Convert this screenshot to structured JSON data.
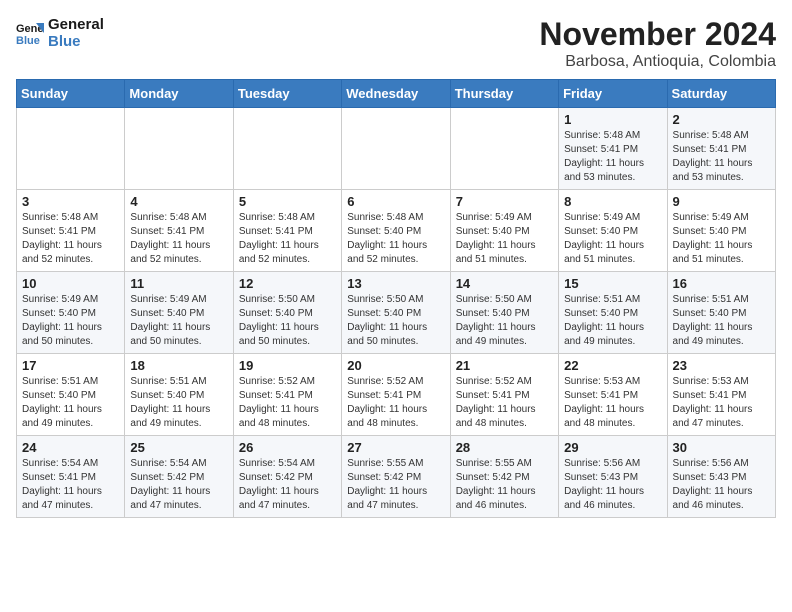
{
  "header": {
    "logo_line1": "General",
    "logo_line2": "Blue",
    "month_title": "November 2024",
    "subtitle": "Barbosa, Antioquia, Colombia"
  },
  "weekdays": [
    "Sunday",
    "Monday",
    "Tuesday",
    "Wednesday",
    "Thursday",
    "Friday",
    "Saturday"
  ],
  "weeks": [
    [
      {
        "day": "",
        "info": ""
      },
      {
        "day": "",
        "info": ""
      },
      {
        "day": "",
        "info": ""
      },
      {
        "day": "",
        "info": ""
      },
      {
        "day": "",
        "info": ""
      },
      {
        "day": "1",
        "info": "Sunrise: 5:48 AM\nSunset: 5:41 PM\nDaylight: 11 hours\nand 53 minutes."
      },
      {
        "day": "2",
        "info": "Sunrise: 5:48 AM\nSunset: 5:41 PM\nDaylight: 11 hours\nand 53 minutes."
      }
    ],
    [
      {
        "day": "3",
        "info": "Sunrise: 5:48 AM\nSunset: 5:41 PM\nDaylight: 11 hours\nand 52 minutes."
      },
      {
        "day": "4",
        "info": "Sunrise: 5:48 AM\nSunset: 5:41 PM\nDaylight: 11 hours\nand 52 minutes."
      },
      {
        "day": "5",
        "info": "Sunrise: 5:48 AM\nSunset: 5:41 PM\nDaylight: 11 hours\nand 52 minutes."
      },
      {
        "day": "6",
        "info": "Sunrise: 5:48 AM\nSunset: 5:40 PM\nDaylight: 11 hours\nand 52 minutes."
      },
      {
        "day": "7",
        "info": "Sunrise: 5:49 AM\nSunset: 5:40 PM\nDaylight: 11 hours\nand 51 minutes."
      },
      {
        "day": "8",
        "info": "Sunrise: 5:49 AM\nSunset: 5:40 PM\nDaylight: 11 hours\nand 51 minutes."
      },
      {
        "day": "9",
        "info": "Sunrise: 5:49 AM\nSunset: 5:40 PM\nDaylight: 11 hours\nand 51 minutes."
      }
    ],
    [
      {
        "day": "10",
        "info": "Sunrise: 5:49 AM\nSunset: 5:40 PM\nDaylight: 11 hours\nand 50 minutes."
      },
      {
        "day": "11",
        "info": "Sunrise: 5:49 AM\nSunset: 5:40 PM\nDaylight: 11 hours\nand 50 minutes."
      },
      {
        "day": "12",
        "info": "Sunrise: 5:50 AM\nSunset: 5:40 PM\nDaylight: 11 hours\nand 50 minutes."
      },
      {
        "day": "13",
        "info": "Sunrise: 5:50 AM\nSunset: 5:40 PM\nDaylight: 11 hours\nand 50 minutes."
      },
      {
        "day": "14",
        "info": "Sunrise: 5:50 AM\nSunset: 5:40 PM\nDaylight: 11 hours\nand 49 minutes."
      },
      {
        "day": "15",
        "info": "Sunrise: 5:51 AM\nSunset: 5:40 PM\nDaylight: 11 hours\nand 49 minutes."
      },
      {
        "day": "16",
        "info": "Sunrise: 5:51 AM\nSunset: 5:40 PM\nDaylight: 11 hours\nand 49 minutes."
      }
    ],
    [
      {
        "day": "17",
        "info": "Sunrise: 5:51 AM\nSunset: 5:40 PM\nDaylight: 11 hours\nand 49 minutes."
      },
      {
        "day": "18",
        "info": "Sunrise: 5:51 AM\nSunset: 5:40 PM\nDaylight: 11 hours\nand 49 minutes."
      },
      {
        "day": "19",
        "info": "Sunrise: 5:52 AM\nSunset: 5:41 PM\nDaylight: 11 hours\nand 48 minutes."
      },
      {
        "day": "20",
        "info": "Sunrise: 5:52 AM\nSunset: 5:41 PM\nDaylight: 11 hours\nand 48 minutes."
      },
      {
        "day": "21",
        "info": "Sunrise: 5:52 AM\nSunset: 5:41 PM\nDaylight: 11 hours\nand 48 minutes."
      },
      {
        "day": "22",
        "info": "Sunrise: 5:53 AM\nSunset: 5:41 PM\nDaylight: 11 hours\nand 48 minutes."
      },
      {
        "day": "23",
        "info": "Sunrise: 5:53 AM\nSunset: 5:41 PM\nDaylight: 11 hours\nand 47 minutes."
      }
    ],
    [
      {
        "day": "24",
        "info": "Sunrise: 5:54 AM\nSunset: 5:41 PM\nDaylight: 11 hours\nand 47 minutes."
      },
      {
        "day": "25",
        "info": "Sunrise: 5:54 AM\nSunset: 5:42 PM\nDaylight: 11 hours\nand 47 minutes."
      },
      {
        "day": "26",
        "info": "Sunrise: 5:54 AM\nSunset: 5:42 PM\nDaylight: 11 hours\nand 47 minutes."
      },
      {
        "day": "27",
        "info": "Sunrise: 5:55 AM\nSunset: 5:42 PM\nDaylight: 11 hours\nand 47 minutes."
      },
      {
        "day": "28",
        "info": "Sunrise: 5:55 AM\nSunset: 5:42 PM\nDaylight: 11 hours\nand 46 minutes."
      },
      {
        "day": "29",
        "info": "Sunrise: 5:56 AM\nSunset: 5:43 PM\nDaylight: 11 hours\nand 46 minutes."
      },
      {
        "day": "30",
        "info": "Sunrise: 5:56 AM\nSunset: 5:43 PM\nDaylight: 11 hours\nand 46 minutes."
      }
    ]
  ]
}
